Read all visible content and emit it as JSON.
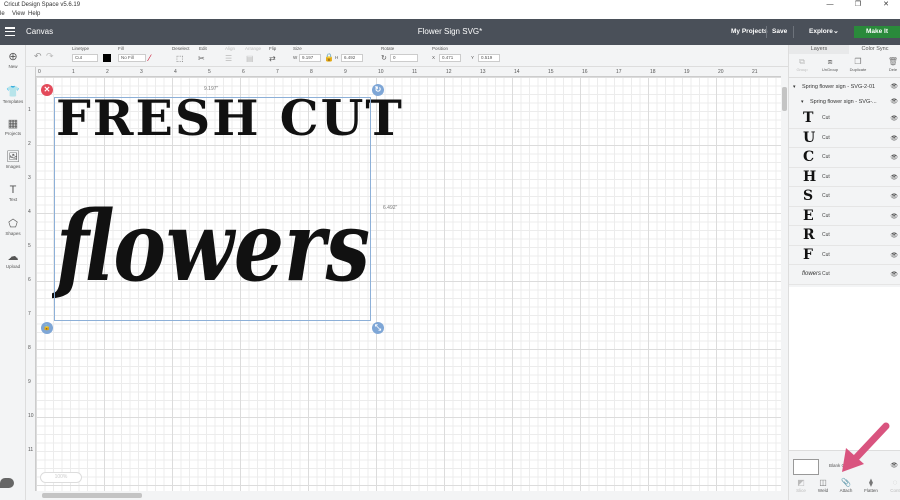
{
  "window": {
    "title": "Cricut Design Space  v5.6.19",
    "min": "—",
    "max": "❐",
    "close": "✕"
  },
  "menu": [
    "le",
    "View",
    "Help"
  ],
  "header": {
    "canvas": "Canvas",
    "title": "Flower Sign SVG*",
    "my_projects": "My Projects",
    "save": "Save",
    "explore": "Explore",
    "make_it": "Make It"
  },
  "toolbar": {
    "linetype": "Linetype",
    "linetype_val": "Cut",
    "fill": "Fill",
    "fill_val": "No Fill",
    "deselect": "Deselect",
    "edit": "Edit",
    "align": "Align",
    "arrange": "Arrange",
    "flip": "Flip",
    "size": "Size",
    "w_label": "W",
    "w_val": "9.197",
    "h_label": "H",
    "h_val": "6.492",
    "rotate": "Rotate",
    "rotate_val": "0",
    "position": "Position",
    "x_label": "X",
    "x_val": "0.471",
    "y_label": "Y",
    "y_val": "0.519"
  },
  "leftbar": [
    {
      "label": "New"
    },
    {
      "label": "Templates"
    },
    {
      "label": "Projects"
    },
    {
      "label": "Images"
    },
    {
      "label": "Text"
    },
    {
      "label": "Shapes"
    },
    {
      "label": "Upload"
    }
  ],
  "ruler_h": [
    "0",
    "1",
    "2",
    "3",
    "4",
    "5",
    "6",
    "7",
    "8",
    "9",
    "10",
    "11",
    "12",
    "13",
    "14",
    "15",
    "16",
    "17",
    "18",
    "19",
    "20",
    "21"
  ],
  "ruler_v": [
    "1",
    "2",
    "3",
    "4",
    "5",
    "6",
    "7",
    "8",
    "9",
    "10",
    "11"
  ],
  "canvas": {
    "width_dim": "9.197\"",
    "height_dim": "6.492\"",
    "text_line1": "FRESH CUT",
    "text_line2": "flowers",
    "zoom": "100%"
  },
  "panel": {
    "tab_layers": "Layers",
    "tab_color_sync": "Color Sync",
    "tools": [
      {
        "label": "Group"
      },
      {
        "label": "UnGroup"
      },
      {
        "label": "Duplicate"
      },
      {
        "label": "Dele"
      }
    ],
    "group1": "Spring flower sign - SVG-2-01",
    "group2": "Spring flower sign - SVG-...",
    "letters": [
      "T",
      "U",
      "C",
      "H",
      "S",
      "E",
      "R",
      "F"
    ],
    "cut_label": "Cut",
    "flowers_thumb": "flowers",
    "blank_canvas": "Blank C",
    "bottom_tools": [
      {
        "label": "Slice"
      },
      {
        "label": "Weld"
      },
      {
        "label": "Attach"
      },
      {
        "label": "Flatten"
      },
      {
        "label": "Cont"
      }
    ]
  },
  "colors": {
    "header": "#4a5059",
    "make_it": "#2a8a3b",
    "selection": "#8db0d8",
    "delete_handle": "#e34a5a",
    "arrow": "#d9547f"
  }
}
